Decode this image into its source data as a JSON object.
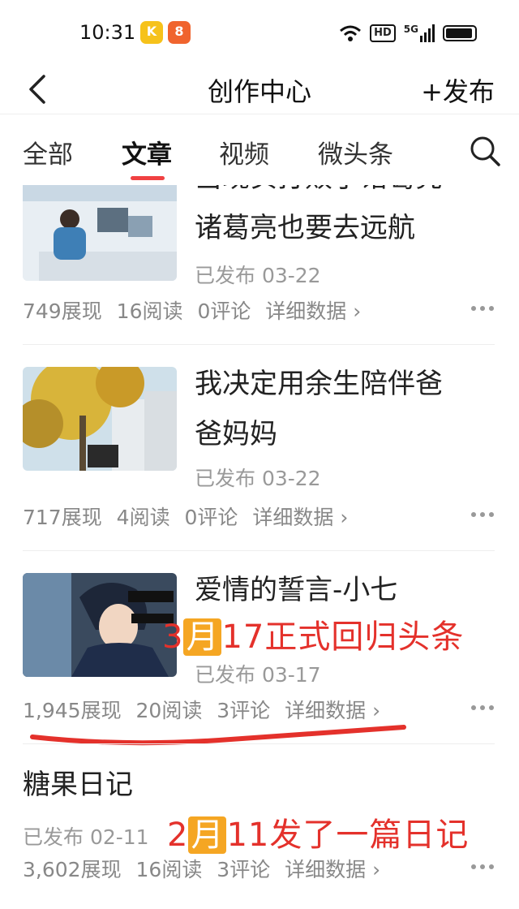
{
  "status_bar": {
    "time": "10:31",
    "badge1": "K",
    "badge2": "8",
    "network": "HD",
    "signal_label": "5G"
  },
  "header": {
    "back_label": "",
    "title": "创作中心",
    "publish_label": "+发布"
  },
  "tabs": [
    {
      "label": "全部"
    },
    {
      "label": "文章"
    },
    {
      "label": "视频"
    },
    {
      "label": "微头条"
    }
  ],
  "articles": [
    {
      "title_line1": "当现实打败了诸葛亮",
      "title_line2": "诸葛亮也要去远航",
      "status": "已发布 03-22",
      "views": "749展现",
      "reads": "16阅读",
      "comments": "0评论",
      "detail": "详细数据 ›"
    },
    {
      "title_line1": "我决定用余生陪伴爸",
      "title_line2": "爸妈妈",
      "status": "已发布 03-22",
      "views": "717展现",
      "reads": "4阅读",
      "comments": "0评论",
      "detail": "详细数据 ›"
    },
    {
      "title_line1": "爱情的誓言-小七",
      "status": "已发布 03-17",
      "views": "1,945展现",
      "reads": "20阅读",
      "comments": "3评论",
      "detail": "详细数据 ›",
      "annotation_pre": "3",
      "annotation_hl": "月",
      "annotation_post": "17正式回归头条"
    },
    {
      "title_line1": "糖果日记",
      "status": "已发布 02-11",
      "views": "3,602展现",
      "reads": "16阅读",
      "comments": "3评论",
      "detail": "详细数据 ›",
      "annotation_pre": "2",
      "annotation_hl": "月",
      "annotation_post": "11发了一篇日记"
    }
  ],
  "colors": {
    "accent": "#f04142",
    "annotation": "#e4312b",
    "highlight": "#f5a623"
  }
}
